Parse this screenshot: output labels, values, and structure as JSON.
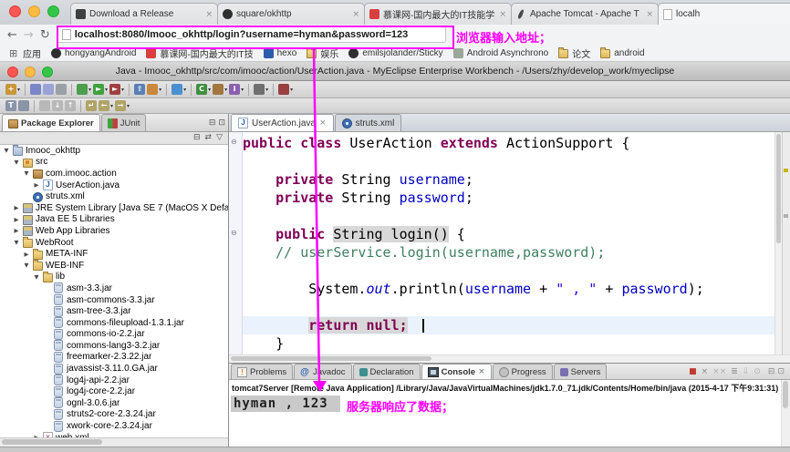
{
  "colors": {
    "accent": "#ff00ff"
  },
  "annotations": {
    "address_note": "浏览器输入地址；",
    "console_note": "服务器响应了数据；"
  },
  "browser": {
    "tabs": [
      {
        "label": "Download a Release",
        "icon": "release-icon"
      },
      {
        "label": "square/okhttp",
        "icon": "github-icon"
      },
      {
        "label": "慕课网-国内最大的IT技能学",
        "icon": "imooc-icon"
      },
      {
        "label": "Apache Tomcat - Apache T",
        "icon": "tomcat-icon"
      },
      {
        "label": "localh",
        "icon": "page-icon",
        "active": true
      }
    ],
    "nav": {
      "back": "←",
      "forward": "→",
      "reload": "↻"
    },
    "url": "localhost:8080/Imooc_okhttp/login?username=hyman&password=123",
    "bookmarks": [
      {
        "label": "应用",
        "icon": "apps-icon"
      },
      {
        "label": "hongyangAndroid",
        "icon": "github-icon"
      },
      {
        "label": "慕课网-国内最大的IT技",
        "icon": "imooc-icon"
      },
      {
        "label": "hexo",
        "icon": "hexo-icon"
      },
      {
        "label": "娱乐",
        "icon": "folder-icon"
      },
      {
        "label": "emilsjolander/Sticky",
        "icon": "github-icon"
      },
      {
        "label": "Android Asynchrono",
        "icon": "android-icon"
      },
      {
        "label": "论文",
        "icon": "folder-icon"
      },
      {
        "label": "android",
        "icon": "folder-icon"
      }
    ]
  },
  "ide": {
    "title": "Java - Imooc_okhttp/src/com/imooc/action/UserAction.java - MyEclipse Enterprise Workbench - /Users/zhy/develop_work/myeclipse",
    "toolbar_row1": [
      {
        "name": "new-wizard-icon",
        "glyph": "+",
        "bg": "#c9973a",
        "dd": true
      },
      {
        "div": true
      },
      {
        "name": "save-icon",
        "glyph": "",
        "bg": "#7a86c8"
      },
      {
        "name": "save-all-icon",
        "glyph": "",
        "bg": "#9aa3d8"
      },
      {
        "name": "print-icon",
        "glyph": "",
        "bg": "#9aa0a6"
      },
      {
        "div": true
      },
      {
        "name": "debug-icon",
        "glyph": "",
        "bg": "#4d9e4d",
        "dd": true
      },
      {
        "name": "run-icon",
        "glyph": "►",
        "bg": "#3fa23f",
        "dd": true
      },
      {
        "name": "external-tools-icon",
        "glyph": "►",
        "bg": "#a04040",
        "dd": true
      },
      {
        "div": true
      },
      {
        "name": "deploy-icon",
        "glyph": "⇧",
        "bg": "#5a7fb5"
      },
      {
        "name": "server-icon",
        "glyph": "",
        "bg": "#c9883a",
        "dd": true
      },
      {
        "div": true
      },
      {
        "name": "web-browser-icon",
        "glyph": "",
        "bg": "#4a8fd0",
        "dd": true
      },
      {
        "div": true
      },
      {
        "name": "new-class-icon",
        "glyph": "C",
        "bg": "#3f8f3f",
        "dd": true
      },
      {
        "name": "new-package-icon",
        "glyph": "",
        "bg": "#a3763f",
        "dd": true
      },
      {
        "name": "new-interface-icon",
        "glyph": "I",
        "bg": "#8a5fb0",
        "dd": true
      },
      {
        "div": true
      },
      {
        "name": "search-icon",
        "glyph": "",
        "bg": "#6f6f6f",
        "dd": true
      },
      {
        "div": true
      },
      {
        "name": "coverage-icon",
        "glyph": "",
        "bg": "#9a3f3f",
        "dd": true
      }
    ],
    "toolbar_row2": [
      {
        "name": "open-type-icon",
        "glyph": "T",
        "bg": "#8a94a8"
      },
      {
        "name": "search-file-icon",
        "glyph": "",
        "bg": "#8a94a8"
      },
      {
        "div": true
      },
      {
        "name": "mark-occurrences-icon",
        "glyph": "",
        "bg": "#b8b8b8"
      },
      {
        "name": "next-annotation-icon",
        "glyph": "↓",
        "bg": "#b8b8b8"
      },
      {
        "name": "prev-annotation-icon",
        "glyph": "↑",
        "bg": "#b8b8b8"
      },
      {
        "div": true
      },
      {
        "name": "last-edit-icon",
        "glyph": "↵",
        "bg": "#b0a468"
      },
      {
        "name": "back-history-icon",
        "glyph": "←",
        "bg": "#b0a468",
        "dd": true
      },
      {
        "name": "forward-history-icon",
        "glyph": "→",
        "bg": "#b0a468",
        "dd": true
      }
    ],
    "left_panel": {
      "tabs": [
        {
          "label": "Package Explorer",
          "icon": "package-explorer-icon",
          "active": true
        },
        {
          "label": "JUnit",
          "icon": "junit-icon"
        }
      ],
      "window_buttons": [
        {
          "name": "minimize-view-icon",
          "glyph": "⊟"
        },
        {
          "name": "maximize-view-icon",
          "glyph": "⊡"
        }
      ],
      "view_buttons": [
        {
          "name": "collapse-all-icon",
          "glyph": "⊟"
        },
        {
          "name": "link-editor-icon",
          "glyph": "⇄"
        },
        {
          "name": "view-menu-icon",
          "glyph": "▽"
        }
      ],
      "tree": [
        {
          "level": 0,
          "expand": "open",
          "icon": "project-icon",
          "label": "Imooc_okhttp"
        },
        {
          "level": 1,
          "expand": "open",
          "icon": "source-folder-icon",
          "label": "src"
        },
        {
          "level": 2,
          "expand": "open",
          "icon": "package-icon",
          "label": "com.imooc.action"
        },
        {
          "level": 3,
          "expand": "closed",
          "icon": "java-file-icon",
          "label": "UserAction.java"
        },
        {
          "level": 2,
          "expand": "none",
          "icon": "struts-config-icon",
          "label": "struts.xml"
        },
        {
          "level": 1,
          "expand": "closed",
          "icon": "library-icon",
          "label": "JRE System Library [Java SE 7 (MacOS X Defa"
        },
        {
          "level": 1,
          "expand": "closed",
          "icon": "library-icon",
          "label": "Java EE 5 Libraries"
        },
        {
          "level": 1,
          "expand": "closed",
          "icon": "library-icon",
          "label": "Web App Libraries"
        },
        {
          "level": 1,
          "expand": "open",
          "icon": "folder-icon",
          "label": "WebRoot"
        },
        {
          "level": 2,
          "expand": "closed",
          "icon": "folder-icon",
          "label": "META-INF"
        },
        {
          "level": 2,
          "expand": "open",
          "icon": "folder-icon",
          "label": "WEB-INF"
        },
        {
          "level": 3,
          "expand": "open",
          "icon": "folder-icon",
          "label": "lib"
        },
        {
          "level": 4,
          "expand": "none",
          "icon": "jar-icon",
          "label": "asm-3.3.jar"
        },
        {
          "level": 4,
          "expand": "none",
          "icon": "jar-icon",
          "label": "asm-commons-3.3.jar"
        },
        {
          "level": 4,
          "expand": "none",
          "icon": "jar-icon",
          "label": "asm-tree-3.3.jar"
        },
        {
          "level": 4,
          "expand": "none",
          "icon": "jar-icon",
          "label": "commons-fileupload-1.3.1.jar"
        },
        {
          "level": 4,
          "expand": "none",
          "icon": "jar-icon",
          "label": "commons-io-2.2.jar"
        },
        {
          "level": 4,
          "expand": "none",
          "icon": "jar-icon",
          "label": "commons-lang3-3.2.jar"
        },
        {
          "level": 4,
          "expand": "none",
          "icon": "jar-icon",
          "label": "freemarker-2.3.22.jar"
        },
        {
          "level": 4,
          "expand": "none",
          "icon": "jar-icon",
          "label": "javassist-3.11.0.GA.jar"
        },
        {
          "level": 4,
          "expand": "none",
          "icon": "jar-icon",
          "label": "log4j-api-2.2.jar"
        },
        {
          "level": 4,
          "expand": "none",
          "icon": "jar-icon",
          "label": "log4j-core-2.2.jar"
        },
        {
          "level": 4,
          "expand": "none",
          "icon": "jar-icon",
          "label": "ognl-3.0.6.jar"
        },
        {
          "level": 4,
          "expand": "none",
          "icon": "jar-icon",
          "label": "struts2-core-2.3.24.jar"
        },
        {
          "level": 4,
          "expand": "none",
          "icon": "jar-icon",
          "label": "xwork-core-2.3.24.jar"
        },
        {
          "level": 3,
          "expand": "closed",
          "icon": "web-xml-icon",
          "label": "web.xml"
        }
      ]
    },
    "editor": {
      "tabs": [
        {
          "label": "UserAction.java",
          "icon": "java-file-icon",
          "active": true
        },
        {
          "label": "struts.xml",
          "icon": "struts-config-icon"
        }
      ],
      "lines": [
        {
          "fold": true,
          "tokens": [
            [
              "kw",
              "public"
            ],
            [
              "pl",
              " "
            ],
            [
              "kw",
              "class"
            ],
            [
              "pl",
              " UserAction "
            ],
            [
              "kw",
              "extends"
            ],
            [
              "pl",
              " ActionSupport {"
            ]
          ]
        },
        {
          "tokens": []
        },
        {
          "tokens": [
            [
              "pl",
              "    "
            ],
            [
              "kw",
              "private"
            ],
            [
              "pl",
              " String "
            ],
            [
              "var",
              "username"
            ],
            [
              "pl",
              ";"
            ]
          ]
        },
        {
          "tokens": [
            [
              "pl",
              "    "
            ],
            [
              "kw",
              "private"
            ],
            [
              "pl",
              " String "
            ],
            [
              "var",
              "password"
            ],
            [
              "pl",
              ";"
            ]
          ]
        },
        {
          "tokens": []
        },
        {
          "fold": true,
          "tokens": [
            [
              "pl",
              "    "
            ],
            [
              "kw",
              "public"
            ],
            [
              "pl",
              " "
            ],
            [
              "hl",
              "String login()"
            ],
            [
              "pl",
              " {"
            ]
          ]
        },
        {
          "tokens": [
            [
              "pl",
              "    "
            ],
            [
              "com",
              "// userService.login(username,password);"
            ]
          ]
        },
        {
          "tokens": []
        },
        {
          "tokens": [
            [
              "pl",
              "        System."
            ],
            [
              "stat",
              "out"
            ],
            [
              "pl",
              ".println("
            ],
            [
              "var",
              "username"
            ],
            [
              "pl",
              " + "
            ],
            [
              "str",
              "\" , \""
            ],
            [
              "pl",
              " + "
            ],
            [
              "var",
              "password"
            ],
            [
              "pl",
              ");"
            ]
          ]
        },
        {
          "tokens": []
        },
        {
          "current": true,
          "tokens": [
            [
              "pl",
              "        "
            ],
            [
              "khl",
              "return null;"
            ],
            [
              "pl",
              " "
            ],
            [
              "caret",
              ""
            ]
          ]
        },
        {
          "tokens": [
            [
              "pl",
              "    }"
            ]
          ]
        }
      ]
    },
    "bottom_panel": {
      "tabs": [
        {
          "label": "Problems",
          "icon": "problems-icon"
        },
        {
          "label": "Javadoc",
          "icon": "javadoc-icon"
        },
        {
          "label": "Declaration",
          "icon": "declaration-icon"
        },
        {
          "label": "Console",
          "icon": "console-icon",
          "active": true
        },
        {
          "label": "Progress",
          "icon": "progress-icon"
        },
        {
          "label": "Servers",
          "icon": "servers-icon"
        }
      ],
      "buttons": [
        {
          "name": "terminate-icon",
          "glyph": "■",
          "color": "#c0392b"
        },
        {
          "name": "remove-launch-icon",
          "glyph": "×",
          "color": "#8a8a8a"
        },
        {
          "name": "remove-all-launches-icon",
          "glyph": "××",
          "color": "#b0b0b0"
        },
        {
          "name": "clear-console-icon",
          "glyph": "≣",
          "color": "#8a8a8a"
        },
        {
          "name": "scroll-lock-icon",
          "glyph": "⇩",
          "color": "#b0b0b0"
        },
        {
          "name": "pin-console-icon",
          "glyph": "⊙",
          "color": "#b0b0b0"
        }
      ],
      "window_buttons": [
        {
          "name": "minimize-panel-icon",
          "glyph": "⊟"
        },
        {
          "name": "maximize-panel-icon",
          "glyph": "⊡"
        }
      ],
      "console_header": "tomcat7Server [Remote Java Application] /Library/Java/JavaVirtualMachines/jdk1.7.0_71.jdk/Contents/Home/bin/java (2015-4-17 下午9:31:31)",
      "console_output": "hyman , 123"
    }
  }
}
